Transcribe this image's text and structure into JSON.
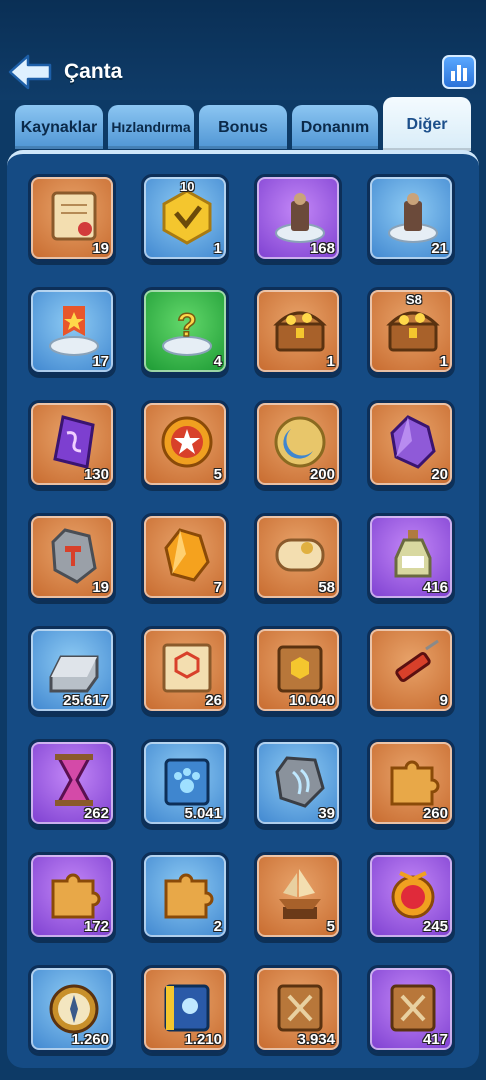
{
  "header": {
    "title": "Çanta"
  },
  "tabs": [
    {
      "label": "Kaynaklar"
    },
    {
      "label": "Hızlandırma"
    },
    {
      "label": "Bonus"
    },
    {
      "label": "Donanım"
    },
    {
      "label": "Diğer"
    }
  ],
  "items": [
    {
      "icon": "scroll-icon",
      "count": "19",
      "color": "orange"
    },
    {
      "icon": "hex-token-icon",
      "count": "1",
      "label": "10",
      "color": "blue"
    },
    {
      "icon": "throne-statue-icon",
      "count": "168",
      "color": "purple"
    },
    {
      "icon": "throne-statue-icon",
      "count": "21",
      "color": "blue"
    },
    {
      "icon": "banner-platform-icon",
      "count": "17",
      "color": "blue"
    },
    {
      "icon": "mystery-platform-icon",
      "count": "4",
      "color": "green"
    },
    {
      "icon": "treasure-chest-icon",
      "count": "1",
      "color": "orange"
    },
    {
      "icon": "treasure-chest-icon",
      "count": "1",
      "label": "S8",
      "color": "orange"
    },
    {
      "icon": "rune-stone-icon",
      "count": "130",
      "color": "orange"
    },
    {
      "icon": "medal-coin-icon",
      "count": "5",
      "color": "orange"
    },
    {
      "icon": "moon-coin-icon",
      "count": "200",
      "color": "orange"
    },
    {
      "icon": "purple-crystal-icon",
      "count": "20",
      "color": "orange"
    },
    {
      "icon": "hammer-stone-icon",
      "count": "19",
      "color": "orange"
    },
    {
      "icon": "amber-gem-icon",
      "count": "7",
      "color": "orange"
    },
    {
      "icon": "rolled-scroll-icon",
      "count": "58",
      "color": "orange"
    },
    {
      "icon": "potion-bottle-icon",
      "count": "416",
      "color": "purple"
    },
    {
      "icon": "silver-ingot-icon",
      "count": "25.617",
      "color": "blue"
    },
    {
      "icon": "blueprint-icon",
      "count": "26",
      "color": "orange"
    },
    {
      "icon": "brown-book-icon",
      "count": "10.040",
      "color": "orange"
    },
    {
      "icon": "syringe-icon",
      "count": "9",
      "color": "orange"
    },
    {
      "icon": "hourglass-potion-icon",
      "count": "262",
      "color": "purple"
    },
    {
      "icon": "paw-book-icon",
      "count": "5.041",
      "color": "blue"
    },
    {
      "icon": "claw-stone-icon",
      "count": "39",
      "color": "blue"
    },
    {
      "icon": "puzzle-piece-icon",
      "count": "260",
      "color": "orange"
    },
    {
      "icon": "puzzle-piece-icon",
      "count": "172",
      "color": "purple"
    },
    {
      "icon": "puzzle-piece-icon",
      "count": "2",
      "color": "blue"
    },
    {
      "icon": "ship-trophy-icon",
      "count": "5",
      "color": "orange"
    },
    {
      "icon": "ruby-amulet-icon",
      "count": "245",
      "color": "purple"
    },
    {
      "icon": "compass-icon",
      "count": "1.260",
      "color": "blue"
    },
    {
      "icon": "blue-tome-icon",
      "count": "1.210",
      "color": "orange"
    },
    {
      "icon": "sword-book-icon",
      "count": "3.934",
      "color": "orange"
    },
    {
      "icon": "sword-book-icon",
      "count": "417",
      "color": "purple"
    }
  ]
}
